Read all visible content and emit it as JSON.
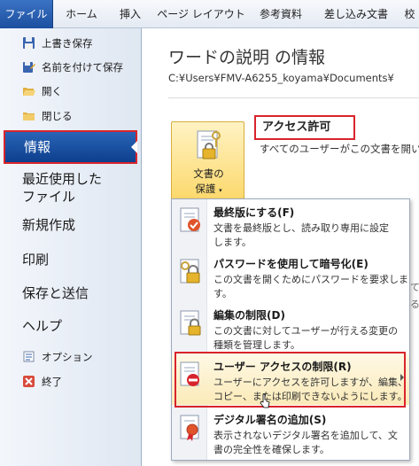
{
  "ribbon": {
    "tabs": [
      {
        "label": "ファイル"
      },
      {
        "label": "ホーム"
      },
      {
        "label": "挿入"
      },
      {
        "label": "ページ レイアウト"
      },
      {
        "label": "参考資料"
      },
      {
        "label": "差し込み文書"
      },
      {
        "label": "校"
      }
    ]
  },
  "sidebar": {
    "commands": [
      {
        "label": "上書き保存",
        "icon": "save-icon"
      },
      {
        "label": "名前を付けて保存",
        "icon": "save-as-icon"
      },
      {
        "label": "開く",
        "icon": "open-folder-icon"
      },
      {
        "label": "閉じる",
        "icon": "close-folder-icon"
      }
    ],
    "items": [
      {
        "label": "情報",
        "active": true
      },
      {
        "label": "最近使用した"
      },
      {
        "label": "ファイル"
      },
      {
        "label": "新規作成"
      },
      {
        "label": "印刷"
      },
      {
        "label": "保存と送信"
      },
      {
        "label": "ヘルプ"
      }
    ],
    "bottom": [
      {
        "label": "オプション",
        "icon": "options-icon"
      },
      {
        "label": "終了",
        "icon": "exit-icon"
      }
    ]
  },
  "main": {
    "title": "ワードの説明 の情報",
    "path": "C:¥Users¥FMV-A6255_koyama¥Documents¥",
    "protect_button": {
      "line1": "文書の",
      "line2": "保護",
      "caret": "▾"
    },
    "permissions": {
      "title": "アクセス許可",
      "description": "すべてのユーザーがこの文書を開い"
    },
    "hint1": "て",
    "hint2": "る"
  },
  "menu": {
    "items": [
      {
        "title": "最終版にする(F)",
        "desc1": "文書を最終版とし、読み取り専用に設定",
        "desc2": "します。",
        "icon": "mark-final-icon"
      },
      {
        "title": "パスワードを使用して暗号化(E)",
        "desc1": "この文書を開くためにパスワードを要求しま",
        "desc2": "す。",
        "icon": "encrypt-key-icon"
      },
      {
        "title": "編集の制限(D)",
        "desc1": "この文書に対してユーザーが行える変更の",
        "desc2": "種類を管理します。",
        "icon": "restrict-editing-icon"
      },
      {
        "title": "ユーザー アクセスの制限(R)",
        "desc1": "ユーザーにアクセスを許可しますが、編集、",
        "desc2": "コピー、または印刷できないようにします。",
        "icon": "restrict-access-icon",
        "highlighted": true
      },
      {
        "title": "デジタル署名の追加(S)",
        "desc1": "表示されないデジタル署名を追加して、文",
        "desc2": "書の完全性を確保します。",
        "icon": "digital-signature-icon"
      }
    ]
  },
  "colors": {
    "accent_red": "#d8242c",
    "file_tab": "#2a5caa",
    "active_nav": "#1a4f9e",
    "protect_button": "#fcd96d"
  }
}
